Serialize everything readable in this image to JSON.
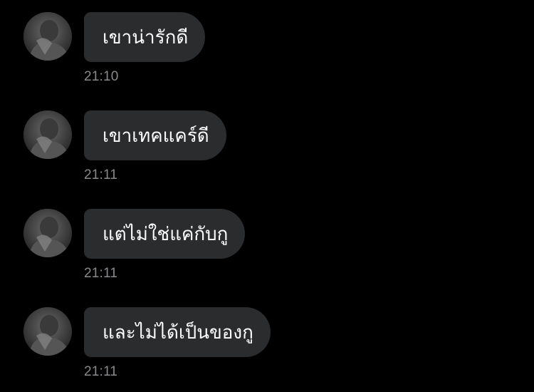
{
  "chat": {
    "colors": {
      "background": "#000000",
      "bubble": "#2b2c2e",
      "text": "#ffffff",
      "timestamp": "#8a8a8e"
    },
    "messages": [
      {
        "avatar_icon": "contact-avatar-photo",
        "text": "เขาน่ารักดี",
        "time": "21:10"
      },
      {
        "avatar_icon": "contact-avatar-photo",
        "text": "เขาเทคแคร์ดี",
        "time": "21:11"
      },
      {
        "avatar_icon": "contact-avatar-photo",
        "text": "แต่ไม่ใช่แค่กับกู",
        "time": "21:11"
      },
      {
        "avatar_icon": "contact-avatar-photo",
        "text": "และไม่ได้เป็นของกู",
        "time": "21:11"
      }
    ]
  }
}
